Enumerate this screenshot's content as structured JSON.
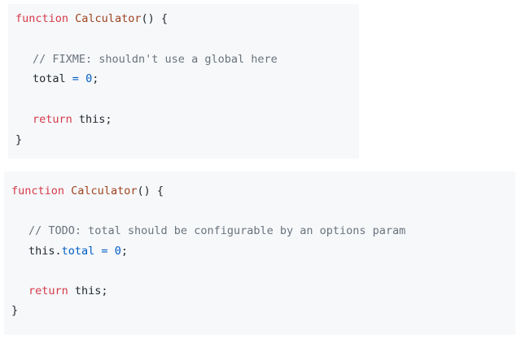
{
  "snippets": [
    {
      "lines": {
        "l1": {
          "keyword": "function",
          "name": "Calculator",
          "punct": "() {"
        },
        "l2": {
          "comment": "// FIXME: shouldn't use a global here"
        },
        "l3": {
          "ident": "total",
          "op": "=",
          "num": "0",
          "punct": ";"
        },
        "l4": {
          "keyword": "return",
          "rest": "this;"
        },
        "l5": {
          "punct": "}"
        }
      }
    },
    {
      "lines": {
        "l1": {
          "keyword": "function",
          "name": "Calculator",
          "punct": "() {"
        },
        "l2": {
          "comment": "// TODO: total should be configurable by an options param"
        },
        "l3": {
          "this": "this.",
          "prop": "total",
          "op": "=",
          "num": "0",
          "punct": ";"
        },
        "l4": {
          "keyword": "return",
          "rest": "this;"
        },
        "l5": {
          "punct": "}"
        }
      }
    }
  ],
  "colors": {
    "background": "#f6f8fa",
    "keyword": "#d73a49",
    "function_name": "#a0421e",
    "comment": "#6a737d",
    "number": "#005cc5",
    "text": "#24292e"
  }
}
